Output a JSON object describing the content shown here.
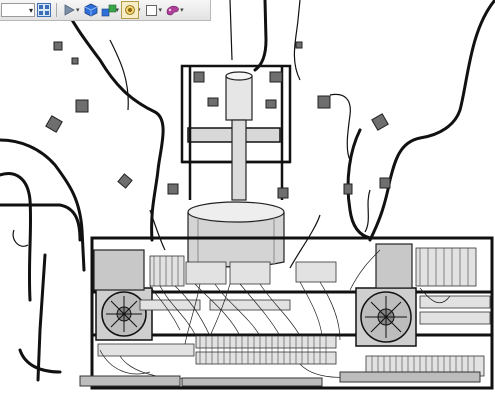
{
  "toolbar": {
    "view_select_value": "",
    "buttons": [
      {
        "name": "grid-layout-icon"
      },
      {
        "name": "play-animation-icon"
      },
      {
        "name": "blue-cube-icon"
      },
      {
        "name": "multi-cube-icon"
      },
      {
        "name": "camera-icon"
      },
      {
        "name": "white-box-icon"
      },
      {
        "name": "material-icon"
      }
    ]
  },
  "colors": {
    "toolbar_bg": "#e8e8e8",
    "cube_blue": "#2f6fd8",
    "material_purple": "#b0419b",
    "model_gray": "#cfcfcf",
    "wire_black": "#111111"
  }
}
